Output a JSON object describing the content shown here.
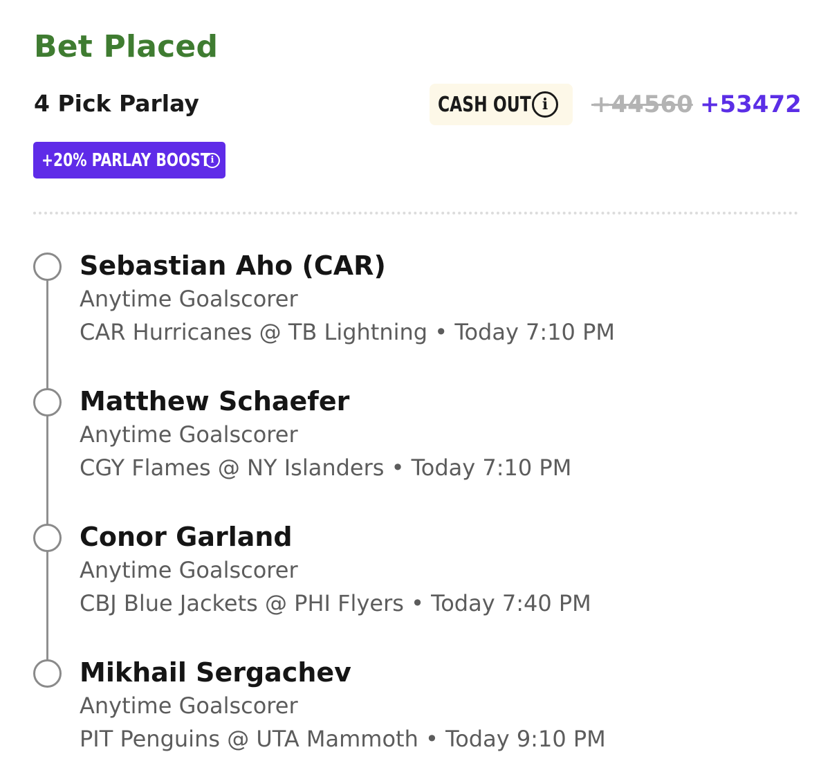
{
  "bet": {
    "status": "Bet Placed",
    "title": "4 Pick Parlay",
    "cash_out_label": "CASH OUT",
    "original_odds": "+44560",
    "boosted_odds": "+53472",
    "boost_label": "+20% PARLAY BOOST"
  },
  "icons": {
    "info": "i"
  },
  "colors": {
    "status_green": "#3f7c31",
    "boost_purple": "#5f2be8",
    "odds_purple": "#5b2ee6",
    "cashout_bg": "#fdf8e8"
  },
  "legs": [
    {
      "player": "Sebastian Aho (CAR)",
      "market": "Anytime Goalscorer",
      "game": "CAR Hurricanes @ TB Lightning • Today 7:10 PM"
    },
    {
      "player": "Matthew Schaefer",
      "market": "Anytime Goalscorer",
      "game": "CGY Flames @ NY Islanders • Today 7:10 PM"
    },
    {
      "player": "Conor Garland",
      "market": "Anytime Goalscorer",
      "game": "CBJ Blue Jackets @ PHI Flyers • Today 7:40 PM"
    },
    {
      "player": "Mikhail Sergachev",
      "market": "Anytime Goalscorer",
      "game": "PIT Penguins @ UTA Mammoth • Today 9:10 PM"
    }
  ]
}
